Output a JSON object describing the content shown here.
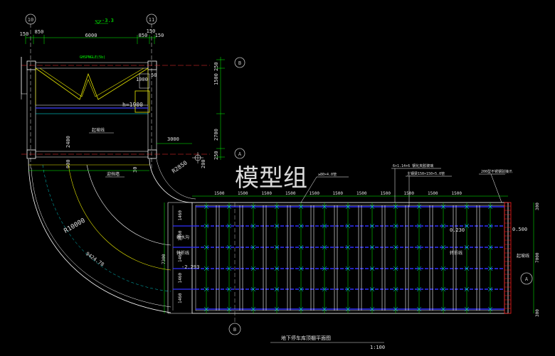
{
  "drawing": {
    "title": "地下停车库顶棚平面图",
    "scale": "1:100",
    "watermark": "模型组",
    "grid_bubbles": [
      "10",
      "11",
      "B",
      "A",
      "B",
      "A"
    ],
    "top_dims": [
      "150",
      "850",
      "6000",
      "850",
      "150",
      "150",
      "150"
    ],
    "elevation_top": "-3.3",
    "side_dims": [
      "250",
      "1500",
      "2700",
      "250"
    ],
    "annotations": {
      "room_label": "GHSPNGLE(5b)",
      "h_label": "h=1900",
      "dim_1000": "1000",
      "dim_50": "50",
      "dim_2400": "2400",
      "dim_900": "900",
      "dim_3000": "3000",
      "dim_30": "30",
      "dim_200": "200",
      "r2850": "R2850",
      "r10000": "R10000",
      "arc_len": "9424.78",
      "slope_line": "起坡线",
      "parapet": "迎挡墙",
      "ditch": "截水沟",
      "ditch2": "排水沟",
      "side_slope": "起坡线",
      "side_slope2": "转折线",
      "level_neg": "-2.293",
      "level_pos": "0.230",
      "level_right": "0.500",
      "note1": "≥80×4.0管",
      "note2": "6+1.14+6 钢化夹胶玻璃",
      "note3": "主钢梁150×150×5.0管",
      "note4": "200型不锈钢驳接爪"
    },
    "grid_dims_top": [
      "1500",
      "1500",
      "1500",
      "1500",
      "1500",
      "1500",
      "1500",
      "1500",
      "1500",
      "1500",
      "1500"
    ],
    "grid_dims_left": [
      "1460",
      "1460",
      "1460",
      "1460",
      "1460"
    ],
    "right_dims": [
      "300",
      "7000",
      "300"
    ],
    "left_total": "7300"
  }
}
